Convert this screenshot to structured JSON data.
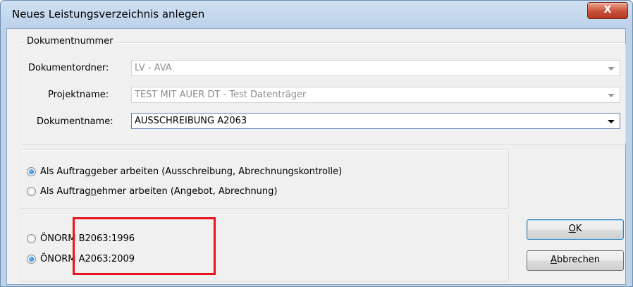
{
  "window": {
    "title": "Neues Leistungsverzeichnis anlegen",
    "close_label": "X"
  },
  "document_group": {
    "legend": "Dokumentnummer",
    "folder_label": "Dokumentordner:",
    "folder_value": "LV - AVA",
    "project_label": "Projektname:",
    "project_value": "TEST MIT AUER DT - Test Datenträger",
    "name_label": "Dokumentname:",
    "name_value": "AUSSCHREIBUNG A2063"
  },
  "role_group": {
    "options": [
      {
        "pre": "Als Auftrag",
        "ul": "g",
        "post": "eber arbeiten (Ausschreibung, Abrechnungskontrolle)",
        "checked": true
      },
      {
        "pre": "Als Auftrag",
        "ul": "n",
        "post": "ehmer arbeiten (Angebot, Abrechnung)",
        "checked": false
      }
    ]
  },
  "norm_group": {
    "options": [
      {
        "label": "ÖNORM B2063:1996",
        "checked": false
      },
      {
        "label": "ÖNORM A2063:2009",
        "checked": true
      }
    ]
  },
  "buttons": {
    "ok": {
      "ul": "O",
      "rest": "K"
    },
    "cancel": {
      "ul": "A",
      "rest": "bbrechen"
    }
  },
  "colors": {
    "highlight_box": "#e8141b",
    "radio_accent": "#1a6ec8"
  }
}
